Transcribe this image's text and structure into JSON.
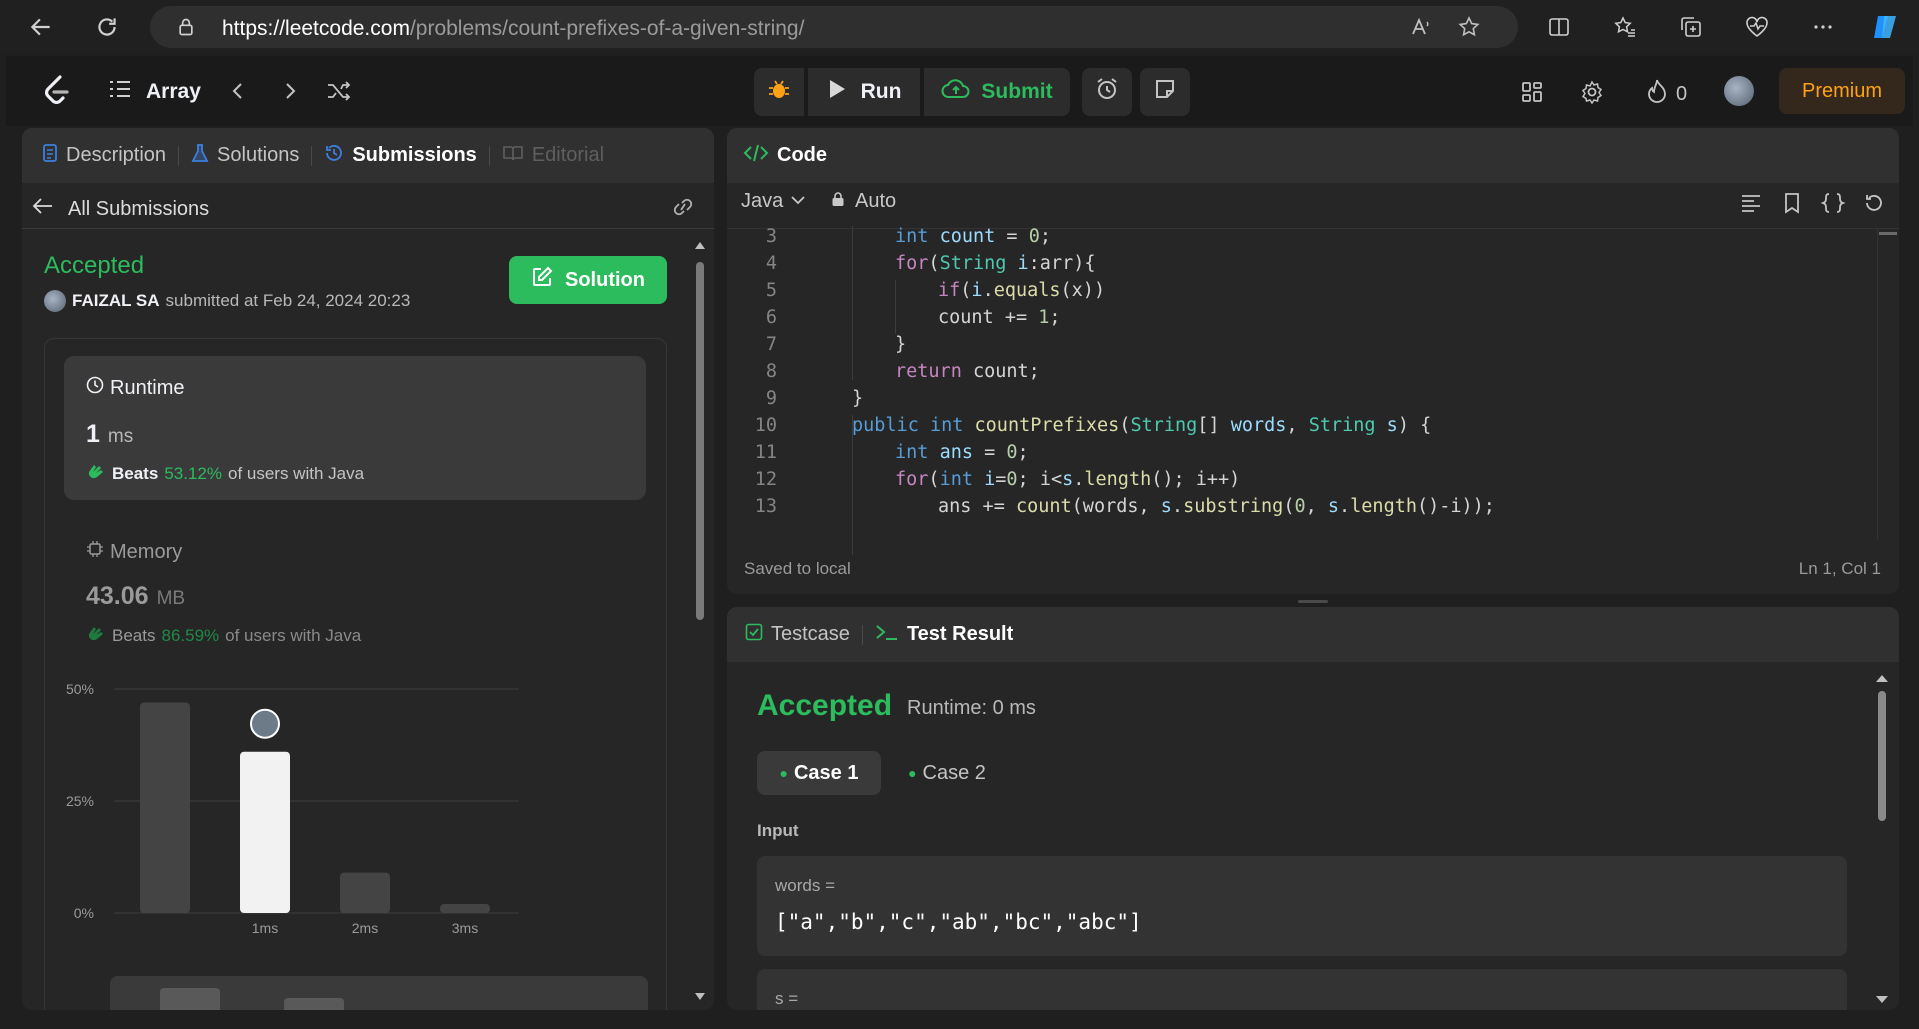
{
  "browser": {
    "url_host": "https://leetcode.com",
    "url_path": "/problems/count-prefixes-of-a-given-string/"
  },
  "nav": {
    "title": "Array",
    "run_label": "Run",
    "submit_label": "Submit",
    "streak_count": "0",
    "premium_label": "Premium"
  },
  "left_panel": {
    "tabs": [
      {
        "label": "Description"
      },
      {
        "label": "Solutions"
      },
      {
        "label": "Submissions"
      },
      {
        "label": "Editorial"
      }
    ],
    "all_submissions": "All Submissions",
    "status": "Accepted",
    "user": "FAIZAL SA",
    "submitted_at": "submitted at Feb 24, 2024 20:23",
    "solution_button": "Solution",
    "runtime": {
      "title": "Runtime",
      "value": "1",
      "unit": "ms",
      "beats_label": "Beats",
      "beats_pct": "53.12%",
      "beats_suffix": "of users with Java"
    },
    "memory": {
      "title": "Memory",
      "value": "43.06",
      "unit": "MB",
      "beats_label": "Beats",
      "beats_pct": "86.59%",
      "beats_suffix": "of users with Java"
    }
  },
  "chart_data": {
    "type": "bar",
    "categories": [
      "",
      "1ms",
      "2ms",
      "3ms"
    ],
    "values": [
      47,
      36,
      9,
      2
    ],
    "highlight_index": 1,
    "yticks": [
      "50%",
      "25%",
      "0%"
    ],
    "ylim": [
      0,
      50
    ]
  },
  "code_panel": {
    "title": "Code",
    "language": "Java",
    "mode": "Auto",
    "status": "Saved to local",
    "cursor": "Ln 1, Col 1",
    "first_line_number": 3
  },
  "bottom_panel": {
    "tabs": [
      {
        "label": "Testcase"
      },
      {
        "label": "Test Result"
      }
    ],
    "status": "Accepted",
    "runtime": "Runtime: 0 ms",
    "cases": [
      "Case 1",
      "Case 2"
    ],
    "input_label": "Input",
    "var1_name": "words =",
    "var1_value": "[\"a\",\"b\",\"c\",\"ab\",\"bc\",\"abc\"]",
    "var2_name": "s ="
  }
}
